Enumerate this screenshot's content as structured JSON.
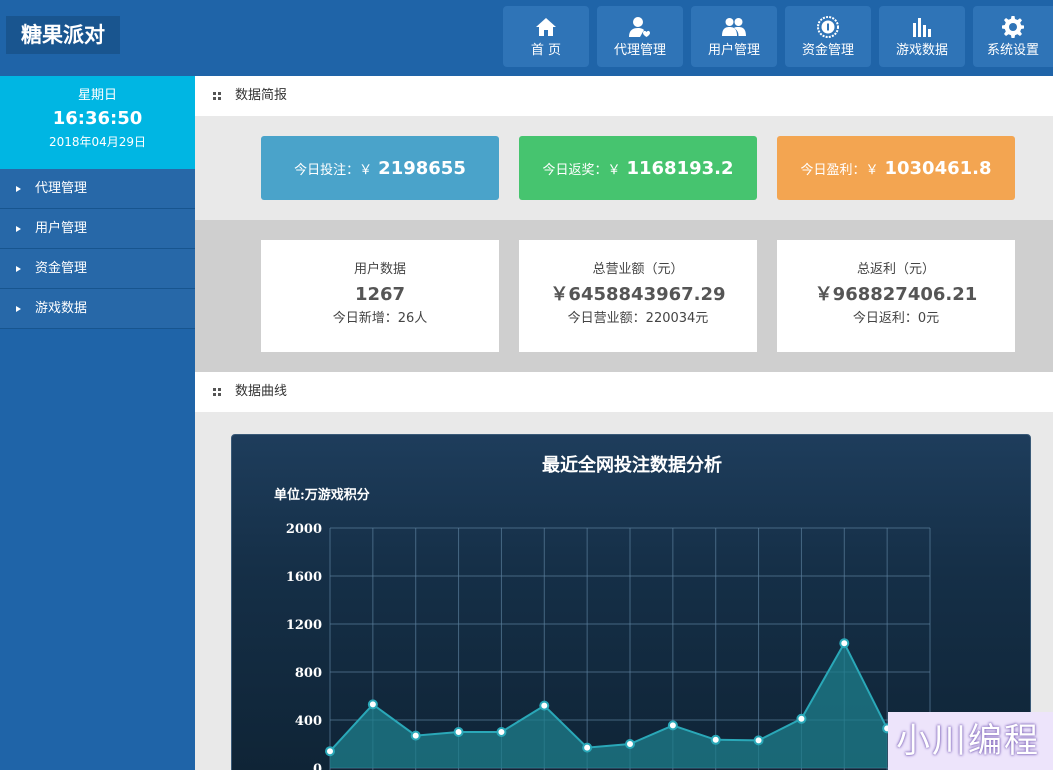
{
  "header": {
    "logo": "糖果派对",
    "nav": [
      {
        "label": "首 页",
        "icon": "home-icon"
      },
      {
        "label": "代理管理",
        "icon": "agent-user-icon"
      },
      {
        "label": "用户管理",
        "icon": "users-icon"
      },
      {
        "label": "资金管理",
        "icon": "coin-icon"
      },
      {
        "label": "游戏数据",
        "icon": "bar-chart-icon"
      },
      {
        "label": "系统设置",
        "icon": "gear-icon"
      }
    ]
  },
  "sidebar": {
    "weekday": "星期日",
    "time": "16:36:50",
    "date": "2018年04月29日",
    "items": [
      {
        "label": "代理管理"
      },
      {
        "label": "用户管理"
      },
      {
        "label": "资金管理"
      },
      {
        "label": "游戏数据"
      }
    ]
  },
  "summary": {
    "title": "数据简报",
    "kpis": [
      {
        "label": "今日投注：￥",
        "value": "2198655",
        "color": "#4aa3ca"
      },
      {
        "label": "今日返奖：￥",
        "value": "1168193.2",
        "color": "#46c46f"
      },
      {
        "label": "今日盈利：￥",
        "value": "1030461.8",
        "color": "#f3a551"
      }
    ],
    "stats": [
      {
        "title": "用户数据",
        "value": "1267",
        "sub": "今日新增：26人"
      },
      {
        "title": "总营业额（元）",
        "value": "￥6458843967.29",
        "sub": "今日营业额：220034元"
      },
      {
        "title": "总返利（元）",
        "value": "￥968827406.21",
        "sub": "今日返利：0元"
      }
    ]
  },
  "curve_section": {
    "title": "数据曲线"
  },
  "chart_data": {
    "type": "area",
    "title": "最近全网投注数据分析",
    "ylabel": "单位:万游戏积分",
    "ylim": [
      0,
      2000
    ],
    "yticks": [
      "0",
      "400",
      "800",
      "1200",
      "1600",
      "2000"
    ],
    "ytick_values": [
      0,
      400,
      800,
      1200,
      1600,
      2000
    ],
    "values": [
      140,
      530,
      270,
      300,
      300,
      520,
      170,
      200,
      355,
      235,
      230,
      410,
      1040,
      330
    ],
    "grid": true,
    "line_color": "#2aa8b8",
    "fill_color": "#1d7f8c"
  },
  "watermark": "小川编程"
}
